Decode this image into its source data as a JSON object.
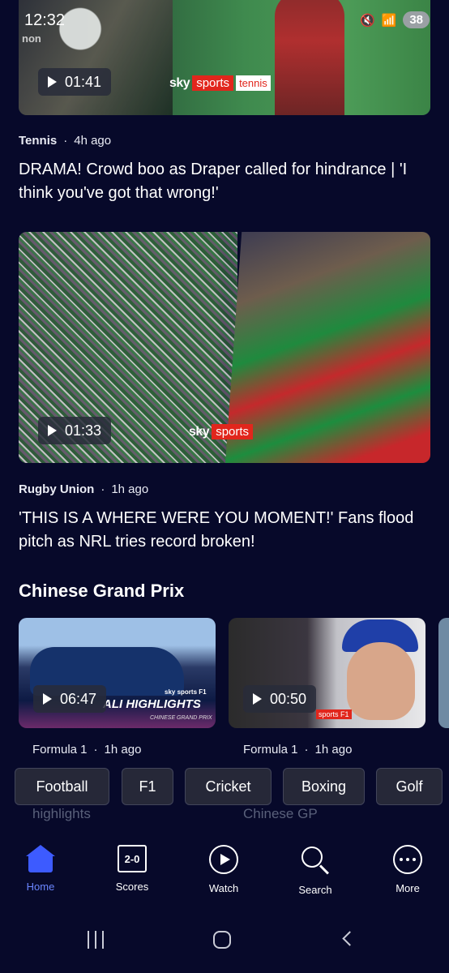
{
  "status_bar": {
    "time": "12:32",
    "battery": "38",
    "corner_text": "non"
  },
  "articles": [
    {
      "duration": "01:41",
      "brand_sky": "sky",
      "brand_sports": "sports",
      "brand_sub": "tennis",
      "category": "Tennis",
      "time_ago": "4h ago",
      "headline": "DRAMA! Crowd boo as Draper called for hindrance | 'I think you've got that wrong!'"
    },
    {
      "duration": "01:33",
      "brand_sky": "sky",
      "brand_sports": "sports",
      "category": "Rugby Union",
      "time_ago": "1h ago",
      "headline": "'THIS IS A WHERE WERE YOU MOMENT!' Fans flood pitch as NRL tries record broken!"
    }
  ],
  "section": {
    "title": "Chinese Grand Prix",
    "cards": [
      {
        "duration": "06:47",
        "overlay_title": "ALI HIGHLIGHTS",
        "overlay_sub": "CHINESE GRAND PRIX",
        "brand": "sky sports F1",
        "category": "Formula 1",
        "time_ago": "1h ago",
        "title_tail": "highlights"
      },
      {
        "duration": "00:50",
        "brand": "sports F1",
        "category": "Formula 1",
        "time_ago": "1h ago",
        "title_tail": "Chinese GP"
      }
    ]
  },
  "chips": [
    "Football",
    "F1",
    "Cricket",
    "Boxing",
    "Golf"
  ],
  "bottom_nav": [
    {
      "label": "Home",
      "icon": "home-icon",
      "active": true
    },
    {
      "label": "Scores",
      "icon": "scores-icon",
      "icon_text": "2-0"
    },
    {
      "label": "Watch",
      "icon": "play-circle-icon"
    },
    {
      "label": "Search",
      "icon": "search-icon"
    },
    {
      "label": "More",
      "icon": "more-icon"
    }
  ],
  "colors": {
    "background": "#07092a",
    "accent": "#3d5bff",
    "sky_red": "#e1261c"
  }
}
